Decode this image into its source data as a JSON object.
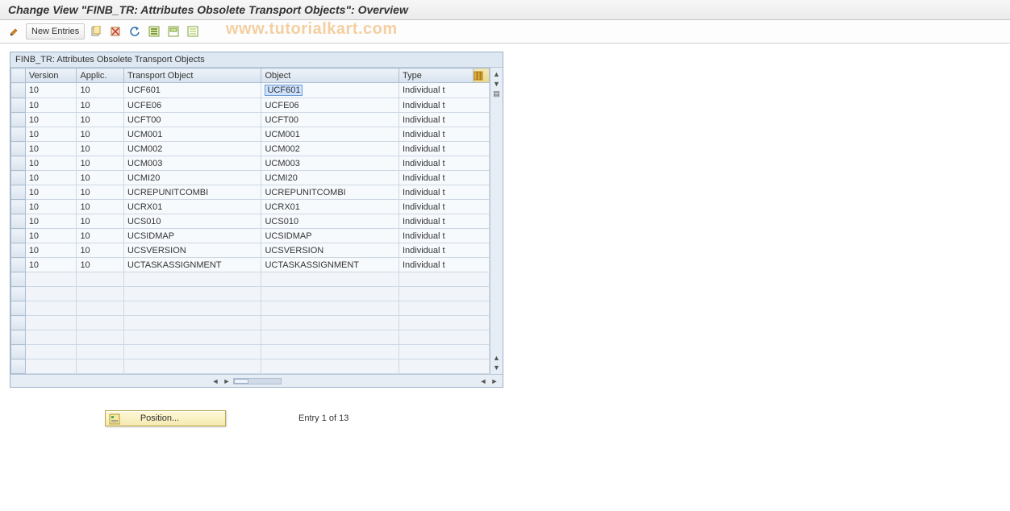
{
  "title": "Change View \"FINB_TR: Attributes Obsolete Transport Objects\": Overview",
  "toolbar": {
    "new_entries": "New Entries"
  },
  "watermark": "www.tutorialkart.com",
  "panel": {
    "title": "FINB_TR: Attributes Obsolete Transport Objects",
    "columns": {
      "version": "Version",
      "applic": "Applic.",
      "transport_object": "Transport Object",
      "object": "Object",
      "type": "Type"
    },
    "rows": [
      {
        "version": "10",
        "applic": "10",
        "tobj": "UCF601",
        "obj": "UCF601",
        "type": "Individual t",
        "selected": true
      },
      {
        "version": "10",
        "applic": "10",
        "tobj": "UCFE06",
        "obj": "UCFE06",
        "type": "Individual t"
      },
      {
        "version": "10",
        "applic": "10",
        "tobj": "UCFT00",
        "obj": "UCFT00",
        "type": "Individual t"
      },
      {
        "version": "10",
        "applic": "10",
        "tobj": "UCM001",
        "obj": "UCM001",
        "type": "Individual t"
      },
      {
        "version": "10",
        "applic": "10",
        "tobj": "UCM002",
        "obj": "UCM002",
        "type": "Individual t"
      },
      {
        "version": "10",
        "applic": "10",
        "tobj": "UCM003",
        "obj": "UCM003",
        "type": "Individual t"
      },
      {
        "version": "10",
        "applic": "10",
        "tobj": "UCMI20",
        "obj": "UCMI20",
        "type": "Individual t"
      },
      {
        "version": "10",
        "applic": "10",
        "tobj": "UCREPUNITCOMBI",
        "obj": "UCREPUNITCOMBI",
        "type": "Individual t"
      },
      {
        "version": "10",
        "applic": "10",
        "tobj": "UCRX01",
        "obj": "UCRX01",
        "type": "Individual t"
      },
      {
        "version": "10",
        "applic": "10",
        "tobj": "UCS010",
        "obj": "UCS010",
        "type": "Individual t"
      },
      {
        "version": "10",
        "applic": "10",
        "tobj": "UCSIDMAP",
        "obj": "UCSIDMAP",
        "type": "Individual t"
      },
      {
        "version": "10",
        "applic": "10",
        "tobj": "UCSVERSION",
        "obj": "UCSVERSION",
        "type": "Individual t"
      },
      {
        "version": "10",
        "applic": "10",
        "tobj": "UCTASKASSIGNMENT",
        "obj": "UCTASKASSIGNMENT",
        "type": "Individual t"
      }
    ],
    "empty_rows": 7
  },
  "footer": {
    "position_label": "Position...",
    "entry_text": "Entry 1 of 13"
  }
}
